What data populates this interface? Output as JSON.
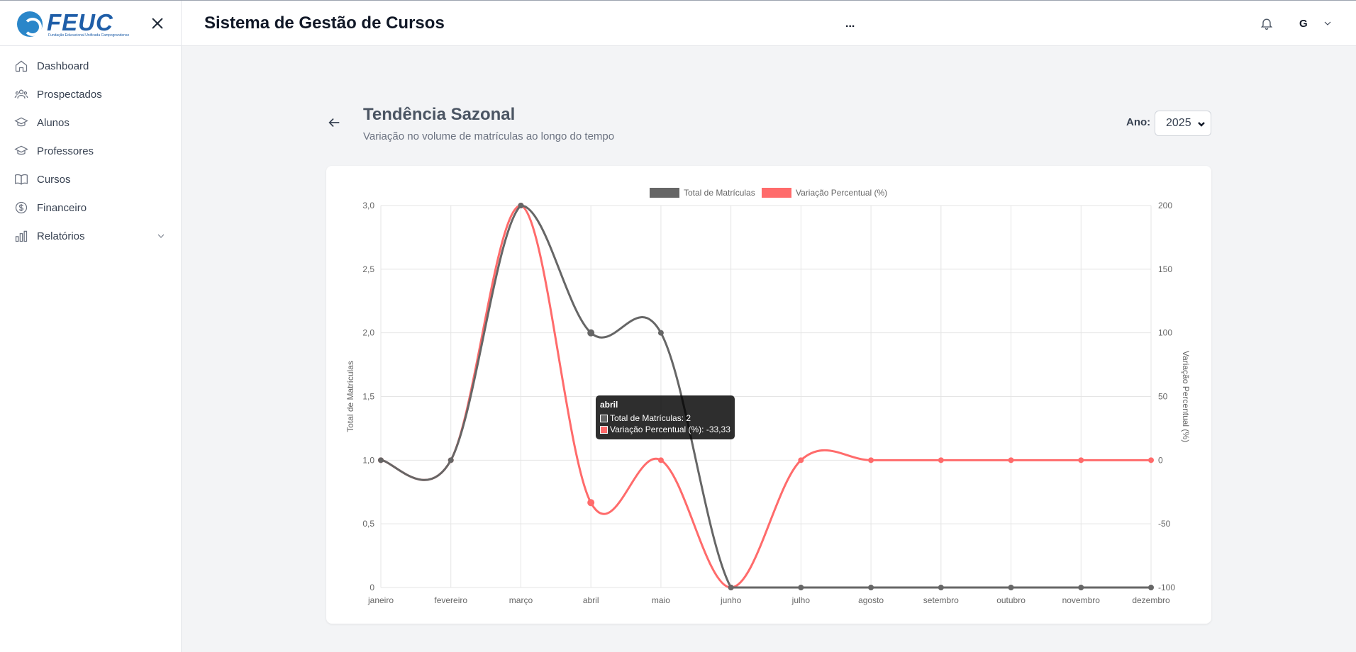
{
  "app": {
    "brand": "FEUC",
    "brand_tagline": "Fundação Educacional Unificada Campograndense",
    "header_title": "Sistema de Gestão de Cursos",
    "header_middle": "...",
    "user_initial": "G"
  },
  "sidebar": {
    "items": [
      {
        "label": "Dashboard",
        "icon": "home-icon"
      },
      {
        "label": "Prospectados",
        "icon": "users-icon"
      },
      {
        "label": "Alunos",
        "icon": "graduation-cap-icon"
      },
      {
        "label": "Professores",
        "icon": "graduation-cap-icon"
      },
      {
        "label": "Cursos",
        "icon": "book-open-icon"
      },
      {
        "label": "Financeiro",
        "icon": "dollar-circle-icon"
      },
      {
        "label": "Relatórios",
        "icon": "bar-chart-icon"
      }
    ]
  },
  "page": {
    "title": "Tendência Sazonal",
    "subtitle": "Variação no volume de matrículas ao longo do tempo",
    "year_label": "Ano:",
    "year_value": "2025"
  },
  "tooltip": {
    "title": "abril",
    "line1": "Total de Matrículas: 2",
    "line2": "Variação Percentual (%): -33,33"
  },
  "colors": {
    "series_total": "#666666",
    "series_variation": "#ff6b6b"
  },
  "chart_data": {
    "type": "line",
    "categories": [
      "janeiro",
      "fevereiro",
      "março",
      "abril",
      "maio",
      "junho",
      "julho",
      "agosto",
      "setembro",
      "outubro",
      "novembro",
      "dezembro"
    ],
    "series": [
      {
        "name": "Total de Matrículas",
        "axis": "left",
        "values": [
          1,
          1,
          3,
          2,
          2,
          0,
          0,
          0,
          0,
          0,
          0,
          0
        ]
      },
      {
        "name": "Variação Percentual (%)",
        "axis": "right",
        "values": [
          0,
          0,
          200,
          -33.33,
          0,
          -100,
          0,
          0,
          0,
          0,
          0,
          0
        ]
      }
    ],
    "ylabel": "Total de Matrículas",
    "y2label": "Variação Percentual (%)",
    "ylim": [
      0,
      3
    ],
    "y2lim": [
      -100,
      200
    ],
    "yticks": [
      "0",
      "0,5",
      "1,0",
      "1,5",
      "2,0",
      "2,5",
      "3,0"
    ],
    "y2ticks": [
      "-100",
      "-50",
      "0",
      "50",
      "100",
      "150",
      "200"
    ],
    "legend": "top-center",
    "grid": true
  }
}
